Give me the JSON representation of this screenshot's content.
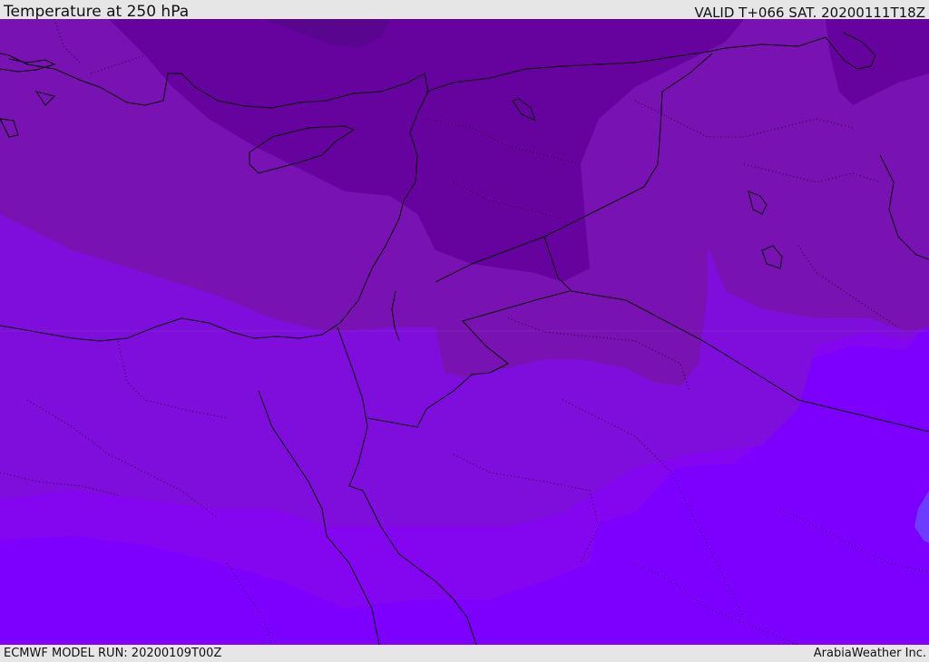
{
  "header": {
    "title": "Temperature at 250 hPa",
    "valid": "VALID T+066 SAT. 20200111T18Z"
  },
  "footer": {
    "model_run": "ECMWF MODEL RUN: 20200109T00Z",
    "credit": "ArabiaWeather Inc."
  },
  "map": {
    "colors": {
      "band_darkest": "#5a0590",
      "band_dark": "#66039e",
      "band_mid": "#7812b2",
      "band_light": "#7f0edc",
      "band_lighter": "#8405f0",
      "band_lightest": "#7d00ff",
      "spot": "#6e3cff",
      "border": "#000000"
    }
  }
}
